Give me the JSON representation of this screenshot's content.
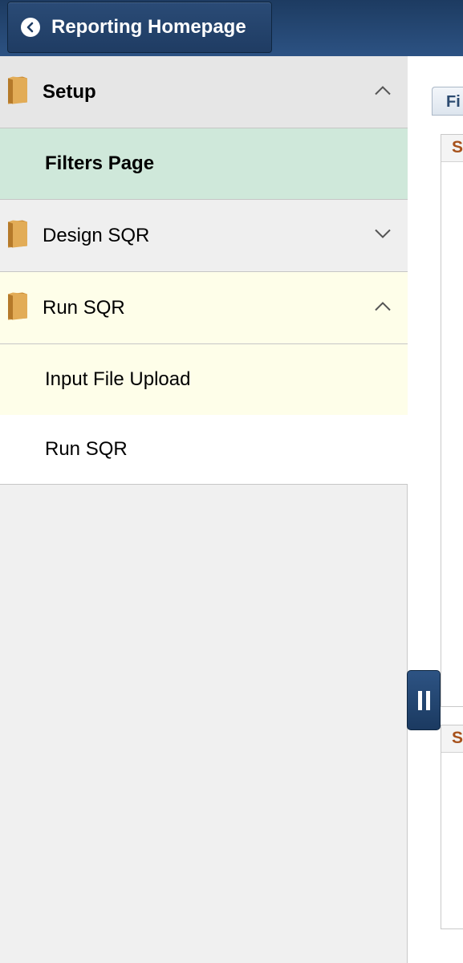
{
  "header": {
    "back_label": "Reporting Homepage"
  },
  "sidebar": {
    "items": [
      {
        "label": "Setup",
        "type": "folder",
        "state": "expanded"
      },
      {
        "label": "Filters Page",
        "type": "page",
        "selected": true
      },
      {
        "label": "Design SQR",
        "type": "folder",
        "state": "collapsed"
      },
      {
        "label": "Run SQR",
        "type": "folder",
        "state": "expanded"
      },
      {
        "label": "Input File Upload",
        "type": "page"
      },
      {
        "label": "Run SQR",
        "type": "page"
      }
    ]
  },
  "content": {
    "tab_label": "Fi",
    "section1_head": "S",
    "section2_head": "S"
  },
  "colors": {
    "header": "#1d3b61",
    "selected_row": "#cfe8da",
    "highlight_row": "#fefee9",
    "folder_icon": "#d9a04a",
    "section_heading": "#a7521c"
  },
  "icons": {
    "back": "chevron-left-icon",
    "folder": "folder-icon",
    "expanded": "chevron-up-icon",
    "collapsed": "chevron-down-icon",
    "splitter": "pause-bars-icon"
  }
}
